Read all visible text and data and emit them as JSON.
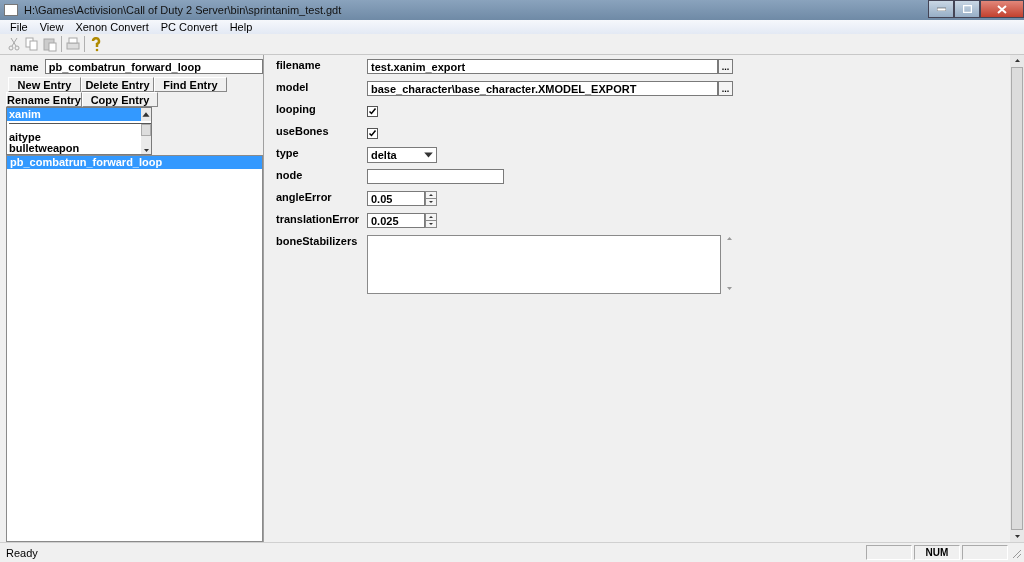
{
  "window": {
    "title": "H:\\Games\\Activision\\Call of Duty 2 Server\\bin\\sprintanim_test.gdt"
  },
  "menu": [
    "File",
    "View",
    "Xenon Convert",
    "PC Convert",
    "Help"
  ],
  "toolbar": {
    "groups": [
      [
        {
          "kind": "cut",
          "disabled": true
        },
        {
          "kind": "copy",
          "disabled": true
        },
        {
          "kind": "paste",
          "disabled": true
        }
      ],
      [
        {
          "kind": "print",
          "disabled": true
        }
      ],
      [
        {
          "kind": "help",
          "disabled": false
        }
      ]
    ]
  },
  "name_field": {
    "label": "name",
    "value": "pb_combatrun_forward_loop"
  },
  "entry_buttons": [
    [
      "New Entry",
      "Delete Entry",
      "Find Entry"
    ],
    [
      "Rename Entry",
      "Copy Entry"
    ]
  ],
  "type_combo": {
    "value": "xanim",
    "options": [
      "aitype",
      "bulletweapon"
    ]
  },
  "entries": [
    {
      "label": "pb_combatrun_forward_loop",
      "selected": true
    }
  ],
  "fields": [
    {
      "label": "filename",
      "kind": "browse",
      "value": "test.xanim_export",
      "button": "..."
    },
    {
      "label": "model",
      "kind": "browse",
      "value": "base_character\\base_character.XMODEL_EXPORT",
      "button": "..."
    },
    {
      "label": "looping",
      "kind": "checkbox",
      "checked": true
    },
    {
      "label": "useBones",
      "kind": "checkbox",
      "checked": true
    },
    {
      "label": "type",
      "kind": "select",
      "value": "delta"
    },
    {
      "label": "node",
      "kind": "text"
    },
    {
      "label": "angleError",
      "kind": "spin",
      "value": "0.05"
    },
    {
      "label": "translationError",
      "kind": "spin",
      "value": "0.025"
    },
    {
      "label": "boneStabilizers",
      "kind": "textarea"
    }
  ],
  "status_bar": {
    "text": "Ready",
    "indicator": "NUM"
  }
}
